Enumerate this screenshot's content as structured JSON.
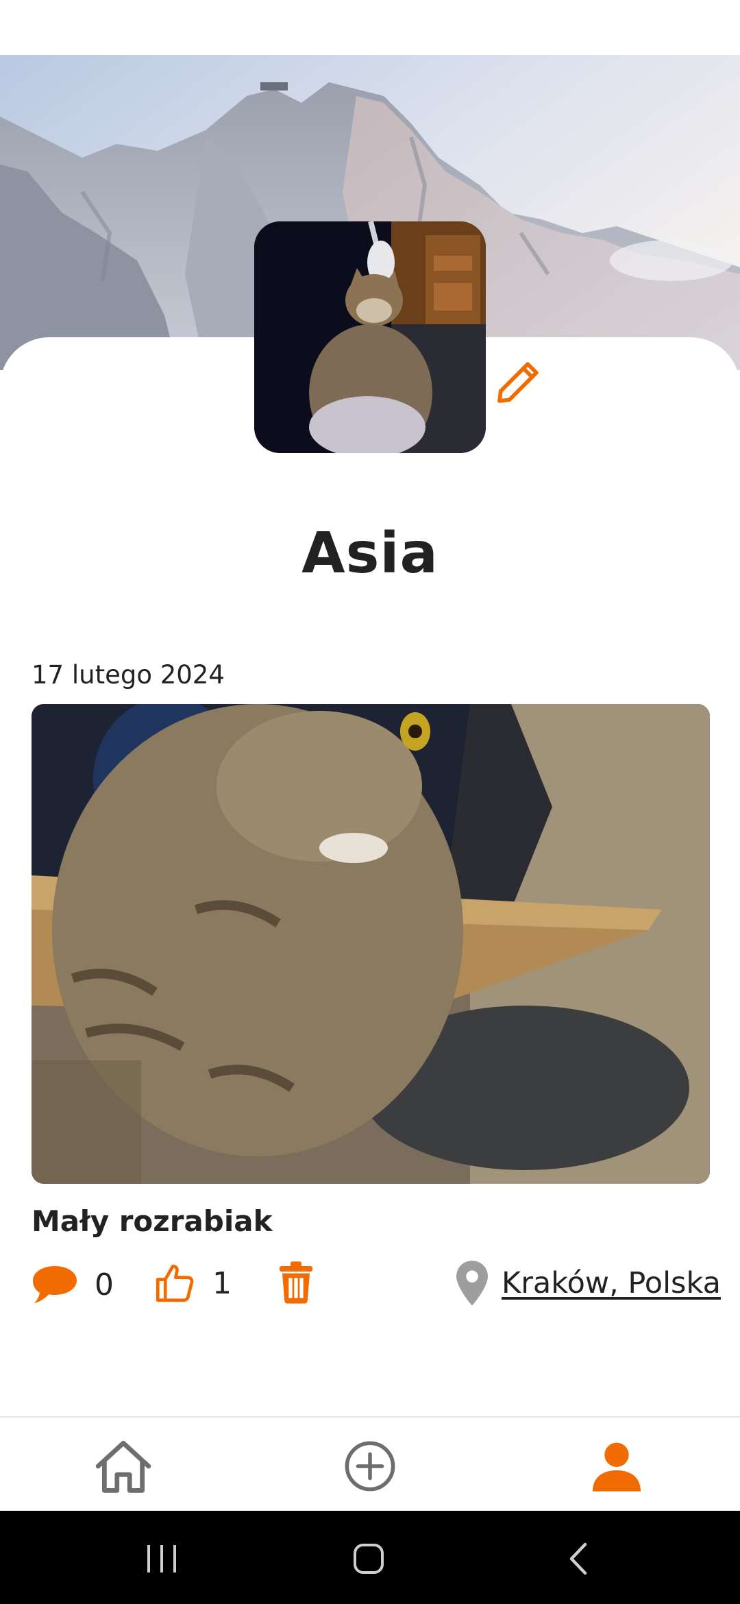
{
  "profile": {
    "name": "Asia"
  },
  "post": {
    "date": "17 lutego 2024",
    "title": "Mały rozrabiak",
    "comments_count": "0",
    "likes_count": "1",
    "location": "Kraków, Polska"
  },
  "colors": {
    "accent": "#F26B00",
    "icon_gray": "#6E6E6E",
    "pin_gray": "#9E9E9E"
  },
  "icons": {
    "edit": "pencil-icon",
    "comment": "speech-bubble-icon",
    "like": "thumbs-up-icon",
    "delete": "trash-icon",
    "location": "location-pin-icon",
    "nav_home": "home-icon",
    "nav_add": "add-circle-icon",
    "nav_profile": "person-icon"
  }
}
